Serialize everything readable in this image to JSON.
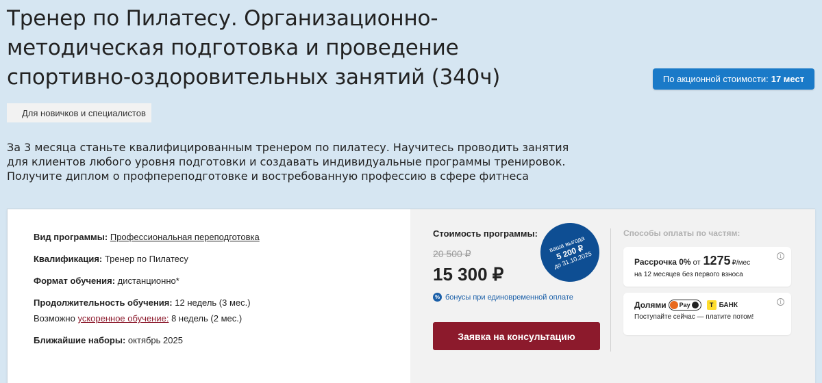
{
  "header": {
    "title": "Тренер по Пилатесу. Организационно-методическая подготовка и проведение спортивно-оздоровительных занятий (340ч)",
    "promo_prefix": "По акционной стоимости:",
    "promo_value": "17 мест",
    "audience_tag": "Для новичков и специалистов",
    "description": "За 3 месяца станьте квалифицированным тренером по пилатесу. Научитесь проводить занятия для клиентов любого уровня подготовки и создавать индивидуальные программы тренировок. Получите диплом о профпереподготовке и востребованную профессию в сфере фитнеса"
  },
  "program": {
    "type_label": "Вид программы:",
    "type_value": "Профессиональная переподготовка",
    "qualification_label": "Квалификация:",
    "qualification_value": "Тренер по Пилатесу",
    "format_label": "Формат обучения:",
    "format_value": "дистанционно*",
    "duration_label": "Продолжительность обучения:",
    "duration_value": "12 недель (3 мес.)",
    "accel_prefix": "Возможно",
    "accel_link": "ускоренное обучение:",
    "accel_value": "8 недель (2 мес.)",
    "enroll_label": "Ближайшие наборы:",
    "enroll_value": "октябрь 2025"
  },
  "pricing": {
    "label": "Стоимость программы:",
    "old_price": "20 500 ₽",
    "new_price": "15 300 ₽",
    "saving_line1": "ваша выгода",
    "saving_amount": "5 200 ₽",
    "saving_until": "до 31.10.2025",
    "bonus_icon": "%",
    "bonus_text": "бонусы при единовременной оплате",
    "cta": "Заявка на консультацию"
  },
  "payment": {
    "title": "Способы оплаты по частям:",
    "installment_label": "Рассрочка 0%",
    "installment_from": "от",
    "installment_amount": "1275",
    "installment_unit": "₽/мес",
    "installment_sub": "на 12 месяцев без первого взноса",
    "dolami_label": "Долями",
    "pay_logo": "Pay",
    "bank_mark": "T",
    "bank_name": "БАНК",
    "dolami_sub": "Поступайте сейчас — платите потом!",
    "info_glyph": "i"
  }
}
